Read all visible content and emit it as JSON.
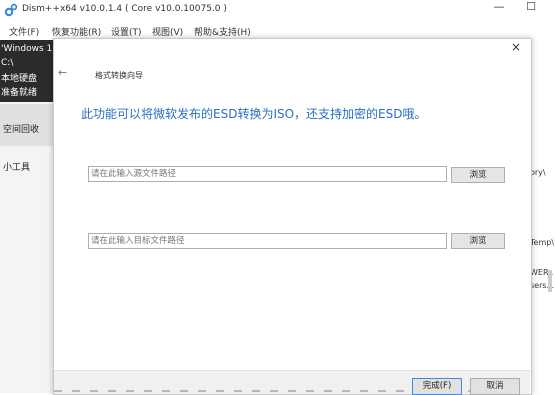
{
  "window": {
    "title": "Dism++x64 v10.0.1.4  ( Core v10.0.10075.0 )",
    "minimize_glyph": "—",
    "maximize_glyph": "☐"
  },
  "menu": {
    "items": [
      "文件(F)",
      "恢复功能(R)",
      "设置(T)",
      "视图(V)",
      "帮助&支持(H)"
    ]
  },
  "sidebar": {
    "system_lines": [
      "'Windows 1",
      "C:\\",
      "本地硬盘",
      "准备就绪"
    ],
    "recycle_label": "空间回收",
    "tools_label": "小工具"
  },
  "background_right": {
    "fragments": [
      "ory\\",
      "Temp\\",
      "WER..",
      "sers..."
    ]
  },
  "dialog": {
    "close_glyph": "×",
    "back_glyph": "←",
    "title": "格式转换向导",
    "description": "此功能可以将微软发布的ESD转换为ISO，还支持加密的ESD哦。",
    "source_placeholder": "请在此输入源文件路径",
    "target_placeholder": "请在此输入目标文件路径",
    "browse_label": "浏览",
    "finish_label": "完成(F)",
    "cancel_label": "取消"
  },
  "colors": {
    "accent_text": "#2a6fc2",
    "system_block": "#2b2b2b",
    "default_button_border": "#4a89d8"
  }
}
